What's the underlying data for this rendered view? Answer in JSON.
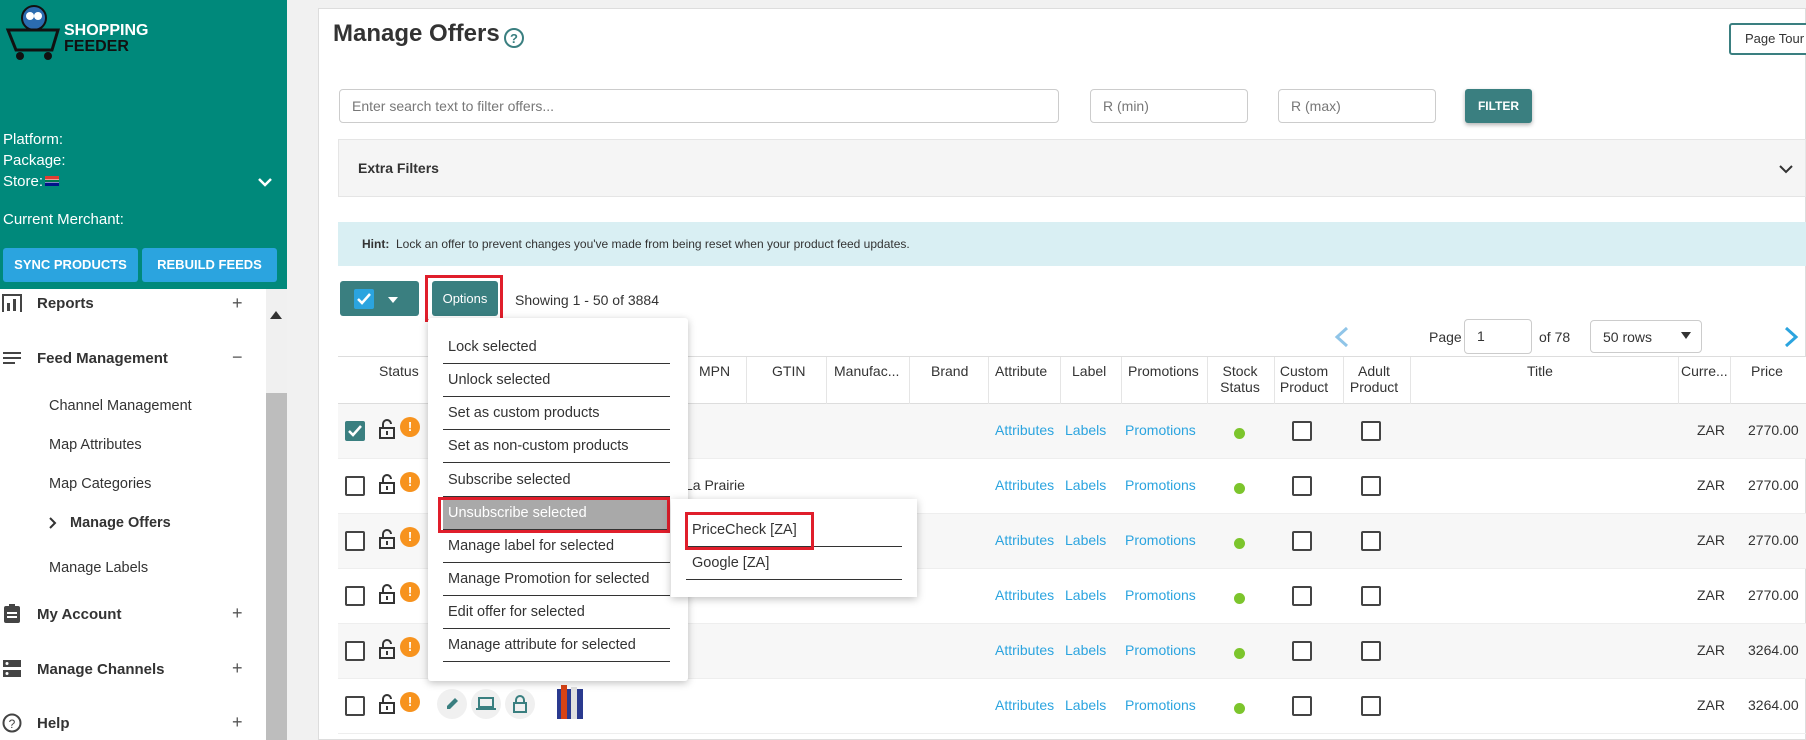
{
  "sidebar": {
    "logo_line1": "SHOPPING",
    "logo_line2": "FEEDER",
    "platform_label": "Platform:",
    "package_label": "Package:",
    "store_label": "Store:",
    "merchant_label": "Current Merchant:",
    "sync_label": "SYNC PRODUCTS",
    "rebuild_label": "REBUILD FEEDS",
    "reports": "Reports",
    "feed_management": "Feed Management",
    "sub_items": [
      "Channel Management",
      "Map Attributes",
      "Map Categories",
      "Manage Offers",
      "Manage Labels"
    ],
    "my_account": "My Account",
    "manage_channels": "Manage Channels",
    "help": "Help"
  },
  "header": {
    "title": "Manage Offers",
    "page_tour": "Page Tour"
  },
  "filters": {
    "search_placeholder": "Enter search text to filter offers...",
    "min_placeholder": "R (min)",
    "max_placeholder": "R (max)",
    "filter_label": "FILTER",
    "extra_filters": "Extra Filters"
  },
  "hint": {
    "label": "Hint:",
    "text": "Lock an offer to prevent changes you've made from being reset when your product feed updates."
  },
  "toolbar": {
    "options_label": "Options",
    "showing": "Showing 1 - 50 of 3884"
  },
  "pagination": {
    "page_label": "Page",
    "page_value": "1",
    "of_label": "of 78",
    "rows_value": "50 rows"
  },
  "columns": {
    "status": "Status",
    "mpn": "MPN",
    "gtin": "GTIN",
    "manufacturer": "Manufac...",
    "brand": "Brand",
    "attribute": "Attribute",
    "label": "Label",
    "promotions": "Promotions",
    "stock1": "Stock",
    "stock2": "Status",
    "custom1": "Custom",
    "custom2": "Product",
    "adult1": "Adult",
    "adult2": "Product",
    "title": "Title",
    "currency": "Curre...",
    "price": "Price"
  },
  "rows": [
    {
      "mpn": "",
      "attributes": "Attributes",
      "labels": "Labels",
      "promotions": "Promotions",
      "currency": "ZAR",
      "price": "2770.00"
    },
    {
      "mpn": "La Prairie",
      "attributes": "Attributes",
      "labels": "Labels",
      "promotions": "Promotions",
      "currency": "ZAR",
      "price": "2770.00"
    },
    {
      "mpn": "",
      "attributes": "Attributes",
      "labels": "Labels",
      "promotions": "Promotions",
      "currency": "ZAR",
      "price": "2770.00"
    },
    {
      "mpn": "",
      "attributes": "Attributes",
      "labels": "Labels",
      "promotions": "Promotions",
      "currency": "ZAR",
      "price": "2770.00"
    },
    {
      "mpn": "",
      "attributes": "Attributes",
      "labels": "Labels",
      "promotions": "Promotions",
      "currency": "ZAR",
      "price": "3264.00"
    },
    {
      "mpn": "",
      "attributes": "Attributes",
      "labels": "Labels",
      "promotions": "Promotions",
      "currency": "ZAR",
      "price": "3264.00"
    }
  ],
  "options_menu": [
    "Lock selected",
    "Unlock selected",
    "Set as custom products",
    "Set as non-custom products",
    "Subscribe selected",
    "Unsubscribe selected",
    "Manage label for selected",
    "Manage Promotion for selected",
    "Edit offer for selected",
    "Manage attribute for selected"
  ],
  "channels_submenu": [
    "PriceCheck [ZA]",
    "Google [ZA]"
  ],
  "colors": {
    "teal": "#00897b",
    "accent": "#3a7f80",
    "blue": "#2ba4df",
    "highlight": "#e01e2b"
  }
}
